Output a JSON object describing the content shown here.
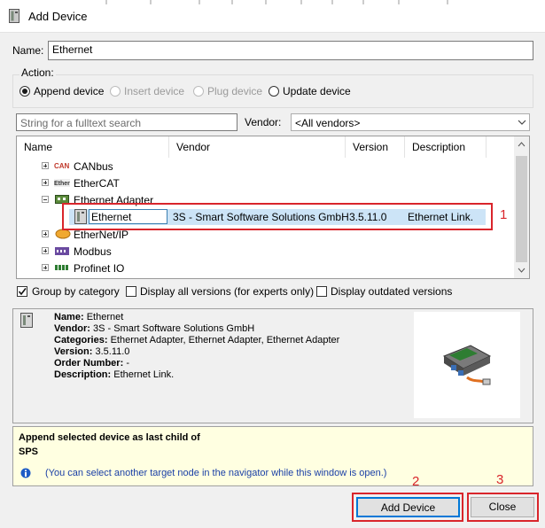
{
  "window": {
    "title": "Add Device"
  },
  "name_field": {
    "label": "Name:",
    "value": "Ethernet"
  },
  "action": {
    "label": "Action:",
    "options": [
      {
        "label": "Append device",
        "selected": true,
        "enabled": true
      },
      {
        "label": "Insert device",
        "selected": false,
        "enabled": false
      },
      {
        "label": "Plug device",
        "selected": false,
        "enabled": false
      },
      {
        "label": "Update device",
        "selected": false,
        "enabled": true
      }
    ]
  },
  "search": {
    "placeholder": "String for a fulltext search",
    "vendor_label": "Vendor:",
    "vendor_value": "<All vendors>"
  },
  "columns": [
    "Name",
    "Vendor",
    "Version",
    "Description"
  ],
  "tree": [
    {
      "label": "CANbus",
      "icon": "can-icon",
      "expanded": false
    },
    {
      "label": "EtherCAT",
      "icon": "ethercat-icon",
      "expanded": false
    },
    {
      "label": "Ethernet Adapter",
      "icon": "ethernet-adapter-icon",
      "expanded": true,
      "children": [
        {
          "name": "Ethernet",
          "vendor": "3S - Smart Software Solutions GmbH",
          "version": "3.5.11.0",
          "description": "Ethernet Link.",
          "selected": true
        }
      ]
    },
    {
      "label": "EtherNet/IP",
      "icon": "ethernetip-icon",
      "expanded": false
    },
    {
      "label": "Modbus",
      "icon": "modbus-icon",
      "expanded": false
    },
    {
      "label": "Profinet IO",
      "icon": "profinet-icon",
      "expanded": false
    }
  ],
  "options": {
    "group_by_category": {
      "label": "Group by category",
      "checked": true
    },
    "display_all_versions": {
      "label": "Display all versions (for experts only)",
      "checked": false
    },
    "display_outdated": {
      "label": "Display outdated versions",
      "checked": false
    }
  },
  "info": {
    "name_label": "Name:",
    "name_value": "Ethernet",
    "vendor_label": "Vendor:",
    "vendor_value": "3S - Smart Software Solutions GmbH",
    "categories_label": "Categories:",
    "categories_value": "Ethernet Adapter, Ethernet Adapter, Ethernet Adapter",
    "version_label": "Version:",
    "version_value": "3.5.11.0",
    "order_label": "Order Number:",
    "order_value": "-",
    "description_label": "Description:",
    "description_value": "Ethernet Link."
  },
  "hint": {
    "line1": "Append selected device as last child of",
    "line2": "SPS",
    "note": "(You can select another target node in the navigator while this window is open.)"
  },
  "buttons": {
    "add": "Add Device",
    "close": "Close"
  },
  "annotations": {
    "one": "1",
    "two": "2",
    "three": "3"
  },
  "colors": {
    "annotation_red": "#d9252b",
    "selection_blue": "#cce4f7",
    "hint_yellow": "#ffffe1"
  }
}
